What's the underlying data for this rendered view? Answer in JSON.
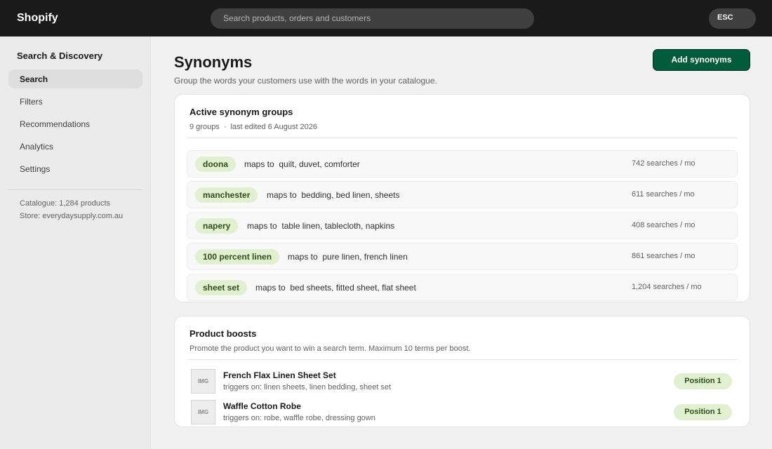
{
  "topbar": {
    "logo": "Shopify",
    "search_placeholder": "Search products, orders and customers",
    "esc_label": "ESC"
  },
  "sidebar": {
    "title": "Search & Discovery",
    "items": [
      {
        "label": "Search",
        "active": true
      },
      {
        "label": "Filters",
        "active": false
      },
      {
        "label": "Recommendations",
        "active": false
      },
      {
        "label": "Analytics",
        "active": false
      },
      {
        "label": "Settings",
        "active": false
      }
    ],
    "catalogue": "Catalogue: 1,284 products",
    "store": "Store: everydaysupply.com.au"
  },
  "main": {
    "title": "Synonyms",
    "subtitle": "Group the words your customers use with the words in your catalogue.",
    "add_button": "Add synonyms"
  },
  "synonym_card": {
    "title": "Active synonym groups",
    "groups_count": "9 groups",
    "separator": "·",
    "last_edited": "last edited 6 August 2026",
    "maps_prefix": "maps to",
    "rows": [
      {
        "term": "doona",
        "maps": "quilt, duvet, comforter",
        "searches": "742 searches / mo"
      },
      {
        "term": "manchester",
        "maps": "bedding, bed linen, sheets",
        "searches": "611 searches / mo"
      },
      {
        "term": "napery",
        "maps": "table linen, tablecloth, napkins",
        "searches": "408 searches / mo"
      },
      {
        "term": "100 percent linen",
        "maps": "pure linen, french linen",
        "searches": "861 searches / mo"
      },
      {
        "term": "sheet set",
        "maps": "bed sheets, fitted sheet, flat sheet",
        "searches": "1,204 searches / mo"
      }
    ]
  },
  "boost_card": {
    "title": "Product boosts",
    "subtitle": "Promote the product you want to win a search term. Maximum 10 terms per boost.",
    "thumb_label": "IMG",
    "rows": [
      {
        "name": "French Flax Linen Sheet Set",
        "triggers": "triggers on: linen sheets, linen bedding, sheet set",
        "badge": "Position 1"
      },
      {
        "name": "Waffle Cotton Robe",
        "triggers": "triggers on: robe, waffle robe, dressing gown",
        "badge": "Position 1"
      }
    ]
  }
}
